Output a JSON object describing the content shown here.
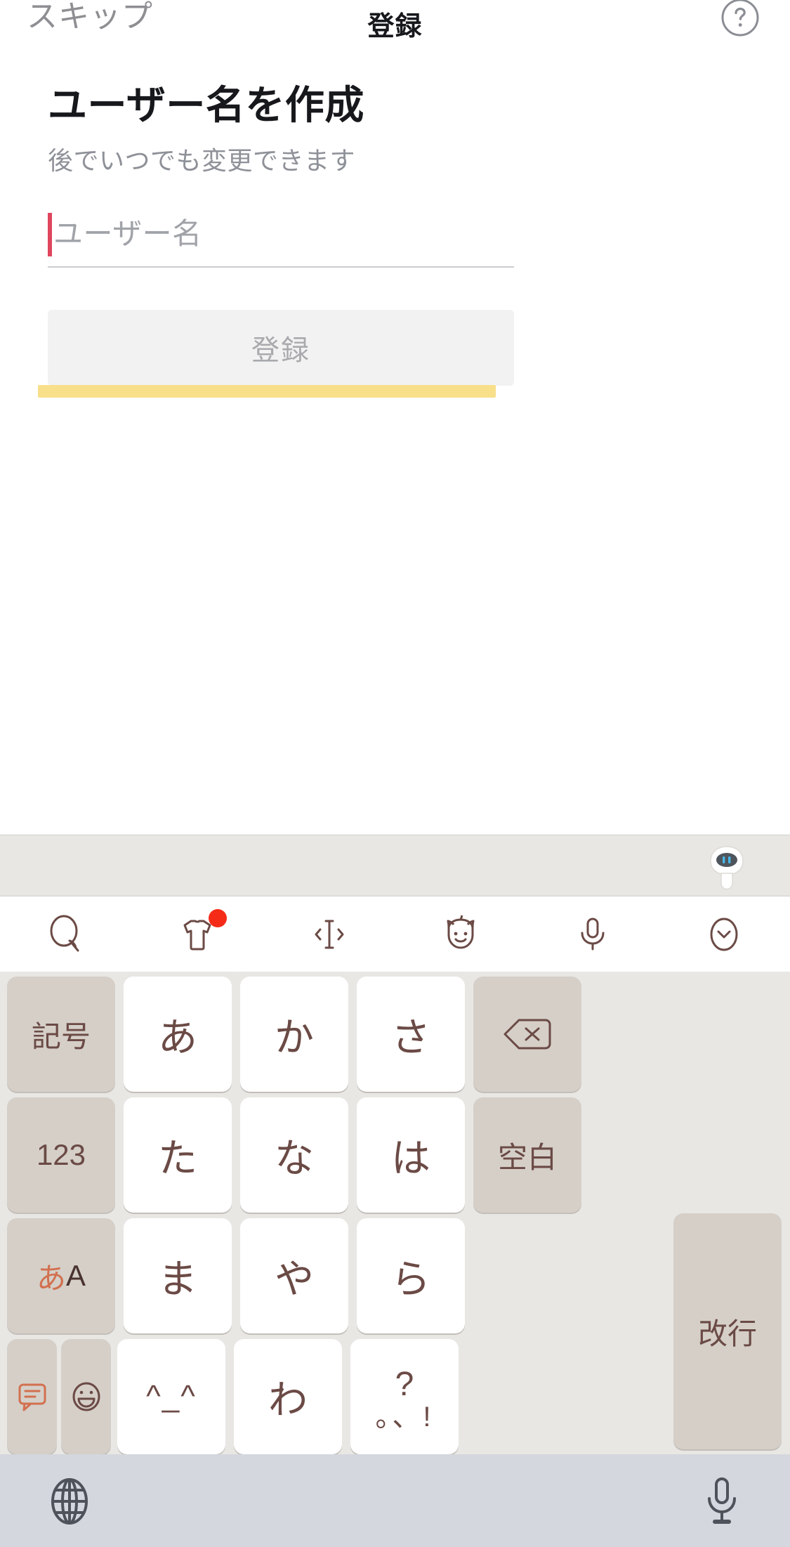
{
  "navbar": {
    "skip_label": "スキップ",
    "title": "登録",
    "help_icon": "question-circle-icon"
  },
  "main": {
    "title": "ユーザー名を作成",
    "subtitle": "後でいつでも変更できます",
    "username_field": {
      "value": "",
      "placeholder": "ユーザー名",
      "caret_color": "#e0455e"
    },
    "submit_button": {
      "label": "登録",
      "enabled": false,
      "background": "#f2f2f2",
      "text_color": "#a8aaad"
    },
    "highlight_bar_color": "#f8df8a"
  },
  "keyboard": {
    "suggestion_bar": {
      "mascot_icon": "robot-mascot-icon",
      "suggestions": []
    },
    "toolbar": [
      {
        "icon": "search-icon",
        "badge": false
      },
      {
        "icon": "tshirt-theme-icon",
        "badge": true
      },
      {
        "icon": "cursor-move-icon",
        "badge": false
      },
      {
        "icon": "sticker-face-icon",
        "badge": false
      },
      {
        "icon": "microphone-icon",
        "badge": false
      },
      {
        "icon": "chevron-down-circle-icon",
        "badge": false
      }
    ],
    "rows": [
      [
        {
          "label": "記号",
          "type": "func"
        },
        {
          "label": "あ",
          "type": "char"
        },
        {
          "label": "か",
          "type": "char"
        },
        {
          "label": "さ",
          "type": "char"
        },
        {
          "label": "",
          "type": "func",
          "icon": "backspace-icon"
        }
      ],
      [
        {
          "label": "123",
          "type": "func"
        },
        {
          "label": "た",
          "type": "char"
        },
        {
          "label": "な",
          "type": "char"
        },
        {
          "label": "は",
          "type": "char"
        },
        {
          "label": "空白",
          "type": "func"
        }
      ],
      [
        {
          "label": "あA",
          "type": "func",
          "kana": "あ",
          "latin": "A"
        },
        {
          "label": "ま",
          "type": "char"
        },
        {
          "label": "や",
          "type": "char"
        },
        {
          "label": "ら",
          "type": "char"
        },
        {
          "label": "改行",
          "type": "enter"
        }
      ],
      [
        {
          "label": "",
          "type": "half",
          "icon": "chat-bubble-icon"
        },
        {
          "label": "",
          "type": "half",
          "icon": "emoji-smile-icon"
        },
        {
          "label": "^_^",
          "type": "char"
        },
        {
          "label": "わ",
          "type": "char"
        },
        {
          "label": "?",
          "sub_label": "。、!",
          "type": "char-punct"
        }
      ]
    ],
    "key_labels": {
      "symbols": "記号",
      "numbers": "123",
      "kana_a": "あ",
      "kana_ka": "か",
      "kana_sa": "さ",
      "kana_ta": "た",
      "kana_na": "な",
      "kana_ha": "は",
      "kana_ma": "ま",
      "kana_ya": "や",
      "kana_ra": "ら",
      "kana_wa": "わ",
      "space": "空白",
      "enter": "改行",
      "mode_kana": "あ",
      "mode_latin": "A",
      "kaomoji": "^_^",
      "punct_top": "?",
      "punct_bottom": "。、!"
    }
  },
  "bottom_bar": {
    "globe_icon": "globe-language-icon",
    "mic_icon": "dictation-microphone-icon",
    "background": "#d4d7dd"
  }
}
